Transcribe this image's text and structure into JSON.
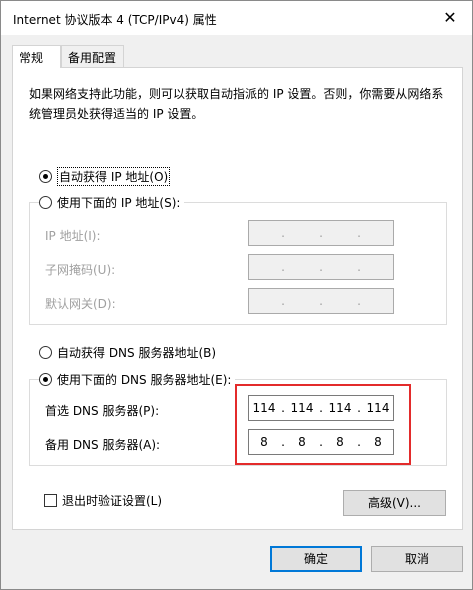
{
  "window": {
    "title": "Internet 协议版本 4 (TCP/IPv4) 属性",
    "close_glyph": "✕"
  },
  "tabs": [
    {
      "label": "常规"
    },
    {
      "label": "备用配置"
    }
  ],
  "description": "如果网络支持此功能，则可以获取自动指派的 IP 设置。否则，你需要从网络系统管理员处获得适当的 IP 设置。",
  "ip": {
    "auto_label": "自动获得 IP 地址(O)",
    "manual_label": "使用下面的 IP 地址(S):",
    "auto_selected": true,
    "fields": [
      {
        "label": "IP 地址(I):"
      },
      {
        "label": "子网掩码(U):"
      },
      {
        "label": "默认网关(D):"
      }
    ]
  },
  "dns": {
    "auto_label": "自动获得 DNS 服务器地址(B)",
    "manual_label": "使用下面的 DNS 服务器地址(E):",
    "manual_selected": true,
    "preferred": {
      "label": "首选 DNS 服务器(P):",
      "octets": [
        "114",
        "114",
        "114",
        "114"
      ]
    },
    "alternate": {
      "label": "备用 DNS 服务器(A):",
      "octets": [
        "8",
        "8",
        "8",
        "8"
      ]
    }
  },
  "validate_label": "退出时验证设置(L)",
  "advanced_label": "高级(V)...",
  "ok_label": "确定",
  "cancel_label": "取消",
  "highlight_color": "#e32b2b",
  "accent_color": "#0078d7"
}
